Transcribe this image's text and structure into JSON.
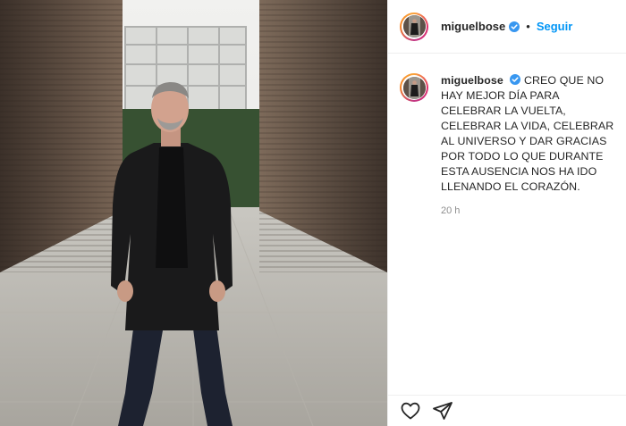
{
  "post": {
    "username": "miguelbose",
    "verified": true,
    "separator": "•",
    "follow_label": "Seguir",
    "caption": "CREO QUE NO HAY MEJOR DÍA PARA CELEBRAR LA VUELTA, CELEBRAR LA VIDA, CELEBRAR AL UNIVERSO Y DAR GRACIAS POR TODO LO QUE DURANTE ESTA AUSENCIA NOS HA IDO LLENANDO EL CORAZÓN.",
    "time_ago": "20 h"
  },
  "icons": {
    "verified": "verified-badge-icon",
    "like": "heart-icon",
    "share": "paper-plane-icon"
  },
  "colors": {
    "accent": "#0095f6",
    "text": "#262626",
    "muted": "#8e8e8e",
    "verified": "#3897f0"
  }
}
